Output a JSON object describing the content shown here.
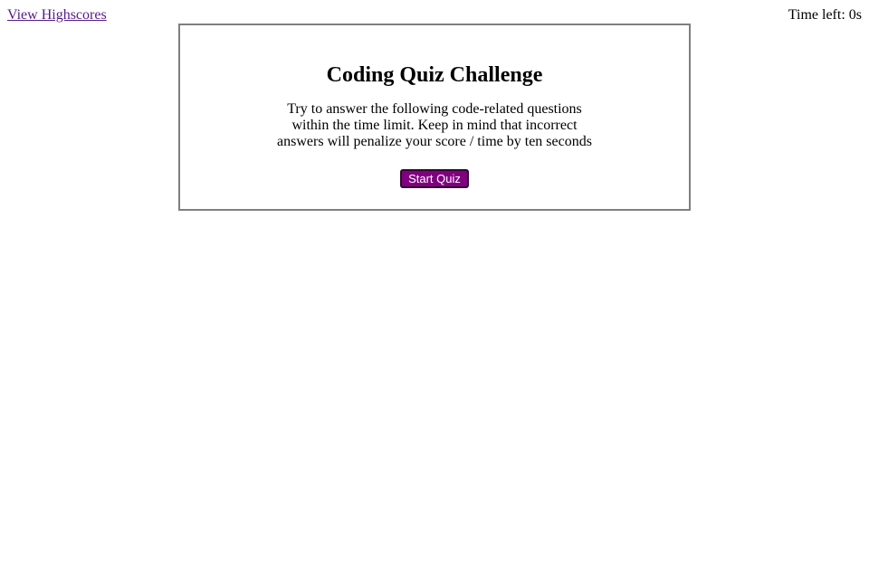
{
  "header": {
    "highscores_link": "View Highscores",
    "timer_text": "Time left: 0s"
  },
  "quiz": {
    "title": "Coding Quiz Challenge",
    "description_lines": [
      "Try to answer the following code-related questions",
      "within the time limit. Keep in mind that incorrect",
      "answers will penalize your score / time by ten seconds"
    ],
    "start_button_label": "Start Quiz"
  },
  "colors": {
    "link": "#551a8b",
    "button_bg": "#800080",
    "card_border": "#7f7f7f"
  }
}
